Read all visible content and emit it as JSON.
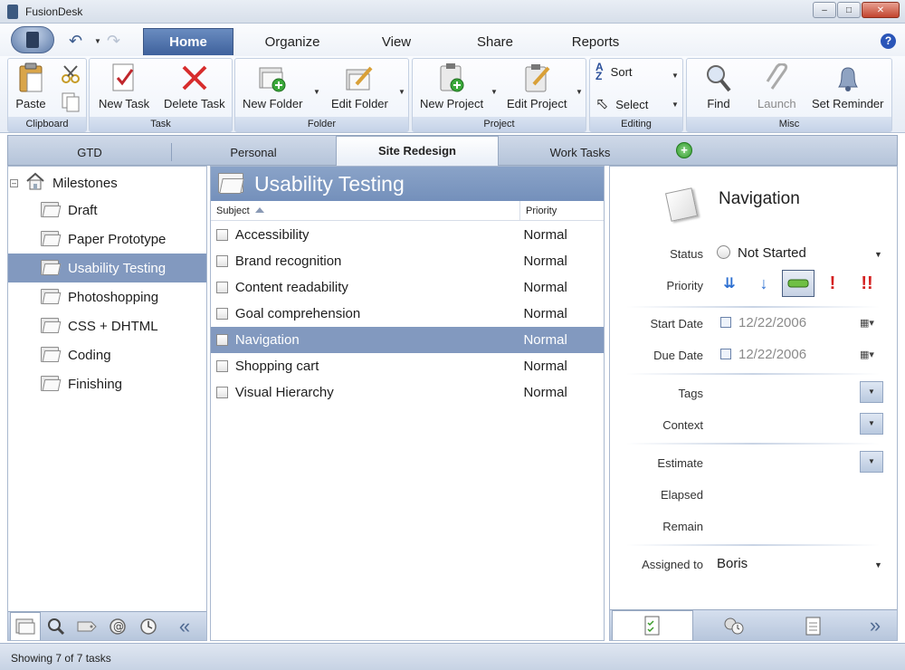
{
  "window": {
    "title": "FusionDesk"
  },
  "ribbon_tabs": [
    {
      "label": "Home",
      "active": true
    },
    {
      "label": "Organize"
    },
    {
      "label": "View"
    },
    {
      "label": "Share"
    },
    {
      "label": "Reports"
    }
  ],
  "ribbon": {
    "clipboard": {
      "label": "Clipboard",
      "paste": "Paste"
    },
    "task": {
      "label": "Task",
      "new_task": "New Task",
      "delete_task": "Delete Task"
    },
    "folder": {
      "label": "Folder",
      "new_folder": "New Folder",
      "edit_folder": "Edit Folder"
    },
    "project": {
      "label": "Project",
      "new_project": "New Project",
      "edit_project": "Edit Project"
    },
    "editing": {
      "label": "Editing",
      "sort": "Sort",
      "select": "Select"
    },
    "misc": {
      "label": "Misc",
      "find": "Find",
      "launch": "Launch",
      "set_reminder": "Set Reminder"
    }
  },
  "project_tabs": [
    "GTD",
    "Personal",
    "Site Redesign",
    "Work Tasks"
  ],
  "project_tabs_selected": "Site Redesign",
  "tree": {
    "root": "Milestones",
    "items": [
      "Draft",
      "Paper Prototype",
      "Usability Testing",
      "Photoshopping",
      "CSS + DHTML",
      "Coding",
      "Finishing"
    ],
    "selected": "Usability Testing"
  },
  "list": {
    "header": "Usability Testing",
    "col_subject": "Subject",
    "col_priority": "Priority",
    "rows": [
      {
        "subject": "Accessibility",
        "priority": "Normal"
      },
      {
        "subject": "Brand recognition",
        "priority": "Normal"
      },
      {
        "subject": "Content readability",
        "priority": "Normal"
      },
      {
        "subject": "Goal comprehension",
        "priority": "Normal"
      },
      {
        "subject": "Navigation",
        "priority": "Normal",
        "selected": true
      },
      {
        "subject": "Shopping cart",
        "priority": "Normal"
      },
      {
        "subject": "Visual Hierarchy",
        "priority": "Normal"
      }
    ]
  },
  "detail": {
    "title": "Navigation",
    "status_label": "Status",
    "status_value": "Not Started",
    "priority_label": "Priority",
    "priority_selected": "normal",
    "start_label": "Start Date",
    "start_value": "12/22/2006",
    "due_label": "Due Date",
    "due_value": "12/22/2006",
    "tags_label": "Tags",
    "context_label": "Context",
    "estimate_label": "Estimate",
    "elapsed_label": "Elapsed",
    "remain_label": "Remain",
    "assigned_label": "Assigned to",
    "assigned_value": "Boris"
  },
  "status_bar": {
    "text": "Showing 7 of 7 tasks"
  },
  "colors": {
    "accent": "#3e619c",
    "selection": "#8299bf",
    "list_header": "#7f99c2"
  }
}
